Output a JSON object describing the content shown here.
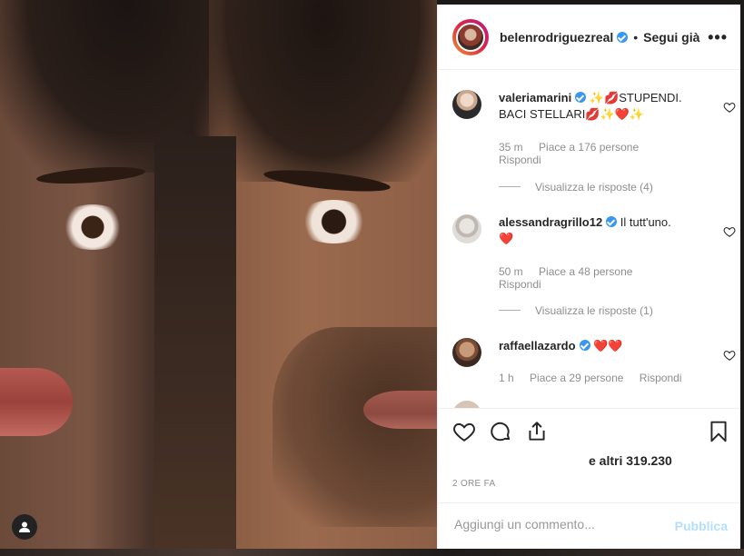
{
  "post": {
    "username": "belenrodriguezreal",
    "follow_label": "Segui già",
    "separator": "•",
    "more_label": "•••"
  },
  "comments": [
    {
      "username": "valeriamarini",
      "text_line1": "✨💋STUPENDI.",
      "text_line2": "BACI STELLARI💋✨❤️✨",
      "time": "35 m",
      "likes": "Piace a 176 persone",
      "reply_label": "Rispondi",
      "view_replies": "Visualizza le risposte (4)"
    },
    {
      "username": "alessandragrillo12",
      "text_line1": "Il tutt'uno.",
      "text_line2": "❤️",
      "time": "50 m",
      "likes": "Piace a 48 persone",
      "reply_label": "Rispondi",
      "view_replies": "Visualizza le risposte (1)"
    },
    {
      "username": "raffaellazardo",
      "text_line1": "❤️❤️",
      "time": "1 h",
      "likes": "Piace a 29 persone",
      "reply_label": "Rispondi"
    }
  ],
  "likes_summary": "e altri 319.230",
  "posted_time": "2 ORE FA",
  "add_comment": {
    "placeholder": "Aggiungi un commento...",
    "publish_label": "Pubblica"
  },
  "colors": {
    "verified": "#3897f0",
    "publish_disabled": "#b2dffc",
    "heart_emoji": "#ed4956"
  },
  "icons": [
    "heart-icon",
    "comment-icon",
    "share-icon",
    "bookmark-icon",
    "more-icon",
    "verified-icon",
    "user-icon"
  ]
}
